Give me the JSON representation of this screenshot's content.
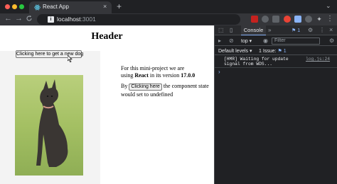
{
  "browser": {
    "tab_title": "React App",
    "tab_close": "×",
    "new_tab": "+",
    "tab_more": "⌄",
    "nav_back": "←",
    "nav_forward": "→",
    "nav_reload": "C",
    "url_host": "localhost",
    "url_port": ":3001"
  },
  "page": {
    "header": "Header",
    "dog_button_label": "Clicking here to get a new dog",
    "desc_line1": "For this mini-project we are",
    "desc_using": "using ",
    "desc_react": "React",
    "desc_version_pre": " in its version ",
    "desc_version": "17.0.0",
    "by_prefix": "By ",
    "inline_button_label": "Clicking here",
    "by_suffix": " the component state would set to undefined"
  },
  "devtools": {
    "tab_console": "Console",
    "more_tabs": "»",
    "issues_badge": "1",
    "context": "top ▾",
    "filter_placeholder": "Filter",
    "levels": "Default levels ▾",
    "issue_text": "1 Issue: ",
    "issue_num": "1",
    "log_message": "[HMR] Waiting for update signal from WDS...",
    "log_source": "log.js:24",
    "prompt": "›"
  },
  "colors": {
    "chrome_bg": "#202124",
    "toolbar_bg": "#35363a",
    "accent": "#8ab4f8",
    "page_bg": "#ffffff"
  },
  "icons": [
    "reload-icon",
    "site-info-icon",
    "inspect-icon",
    "device-icon",
    "settings-icon",
    "kebab-icon",
    "close-icon",
    "clear-console-icon",
    "eye-icon",
    "dog-photo"
  ]
}
